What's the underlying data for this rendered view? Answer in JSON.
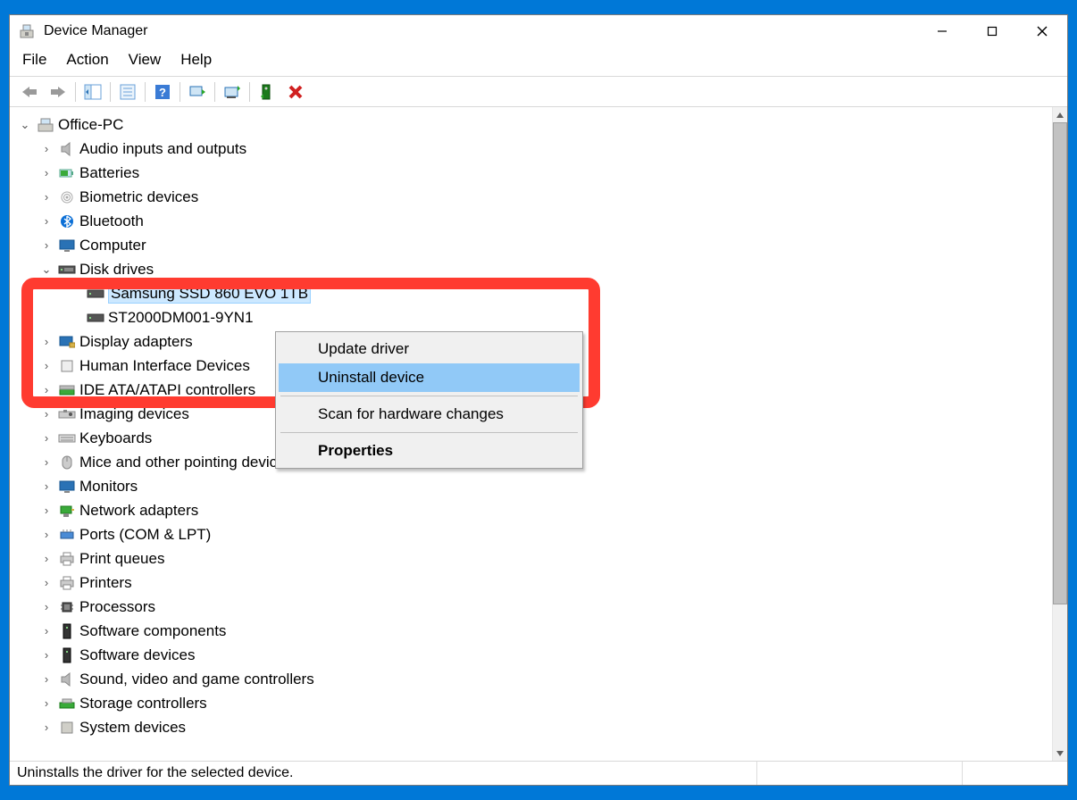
{
  "window": {
    "title": "Device Manager",
    "controls": {
      "minimize": "minimize",
      "maximize": "maximize",
      "close": "close"
    }
  },
  "menubar": {
    "items": [
      "File",
      "Action",
      "View",
      "Help"
    ]
  },
  "toolbar": {
    "back": "back-icon",
    "forward": "forward-icon",
    "show_hidden": "show-hidden-icon",
    "properties": "properties-icon",
    "help": "help-icon",
    "scan": "scan-hardware-icon",
    "update": "update-driver-icon",
    "add_legacy": "add-legacy-icon",
    "uninstall": "uninstall-icon"
  },
  "tree": {
    "root": {
      "label": "Office-PC",
      "expanded": true
    },
    "nodes": [
      {
        "label": "Audio inputs and outputs",
        "icon": "speaker",
        "expanded": false
      },
      {
        "label": "Batteries",
        "icon": "battery",
        "expanded": false
      },
      {
        "label": "Biometric devices",
        "icon": "fingerprint",
        "expanded": false
      },
      {
        "label": "Bluetooth",
        "icon": "bluetooth",
        "expanded": false
      },
      {
        "label": "Computer",
        "icon": "computer",
        "expanded": false
      },
      {
        "label": "Disk drives",
        "icon": "disk",
        "expanded": true,
        "children": [
          {
            "label": "Samsung SSD 860 EVO 1TB",
            "icon": "disk",
            "selected": true
          },
          {
            "label": "ST2000DM001-9YN1",
            "icon": "disk"
          }
        ]
      },
      {
        "label": "Display adapters",
        "icon": "display",
        "expanded": false
      },
      {
        "label": "Human Interface Devices",
        "icon": "hid",
        "expanded": false
      },
      {
        "label": "IDE ATA/ATAPI controllers",
        "icon": "ide",
        "expanded": false
      },
      {
        "label": "Imaging devices",
        "icon": "imaging",
        "expanded": false
      },
      {
        "label": "Keyboards",
        "icon": "keyboard",
        "expanded": false
      },
      {
        "label": "Mice and other pointing devices",
        "icon": "mouse",
        "expanded": false
      },
      {
        "label": "Monitors",
        "icon": "monitor",
        "expanded": false
      },
      {
        "label": "Network adapters",
        "icon": "network",
        "expanded": false
      },
      {
        "label": "Ports (COM & LPT)",
        "icon": "ports",
        "expanded": false
      },
      {
        "label": "Print queues",
        "icon": "printqueue",
        "expanded": false
      },
      {
        "label": "Printers",
        "icon": "printer",
        "expanded": false
      },
      {
        "label": "Processors",
        "icon": "cpu",
        "expanded": false
      },
      {
        "label": "Software components",
        "icon": "swcomp",
        "expanded": false
      },
      {
        "label": "Software devices",
        "icon": "swdev",
        "expanded": false
      },
      {
        "label": "Sound, video and game controllers",
        "icon": "sound",
        "expanded": false
      },
      {
        "label": "Storage controllers",
        "icon": "storage",
        "expanded": false
      },
      {
        "label": "System devices",
        "icon": "system",
        "expanded": false
      }
    ]
  },
  "context_menu": {
    "items": [
      {
        "label": "Update driver",
        "hover": false
      },
      {
        "label": "Uninstall device",
        "hover": true
      },
      {
        "sep": true
      },
      {
        "label": "Scan for hardware changes",
        "hover": false
      },
      {
        "sep": true
      },
      {
        "label": "Properties",
        "hover": false,
        "bold": true
      }
    ]
  },
  "statusbar": {
    "text": "Uninstalls the driver for the selected device."
  },
  "colors": {
    "selection": "#cce8ff",
    "highlight": "#91c9f7",
    "accent": "#0078d7",
    "annotation": "#ff3b30"
  }
}
